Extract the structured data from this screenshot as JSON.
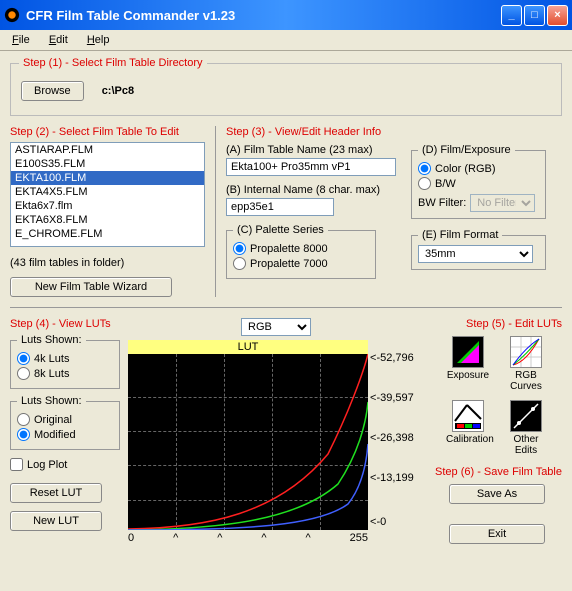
{
  "window": {
    "title": "CFR Film Table Commander v1.23",
    "min": "_",
    "max": "□",
    "close": "×"
  },
  "menu": {
    "file": "File",
    "edit": "Edit",
    "help": "Help"
  },
  "step1": {
    "legend": "Step (1) - Select Film Table Directory",
    "browse": "Browse",
    "path": "c:\\Pc8"
  },
  "step2": {
    "legend": "Step (2) - Select Film Table To Edit",
    "items": [
      "ASTIARAP.FLM",
      "E100S35.FLM",
      "EKTA100.FLM",
      "EKTA4X5.FLM",
      "Ekta6x7.flm",
      "EKTA6X8.FLM",
      "E_CHROME.FLM"
    ],
    "selected_index": 2,
    "count_label": "(43 film tables in folder)",
    "wizard": "New Film Table Wizard"
  },
  "step3": {
    "legend": "Step (3) - View/Edit Header Info",
    "a_label": "(A) Film Table Name (23 max)",
    "a_value": "Ekta100+ Pro35mm vP1",
    "b_label": "(B) Internal Name (8 char. max)",
    "b_value": "epp35e1",
    "c_legend": "(C) Palette Series",
    "c_opt1": "Propalette 8000",
    "c_opt2": "Propalette 7000",
    "d_legend": "(D) Film/Exposure",
    "d_opt1": "Color (RGB)",
    "d_opt2": "B/W",
    "d_filter_label": "BW Filter:",
    "d_filter_value": "No Filter",
    "e_legend": "(E) Film Format",
    "e_value": "35mm"
  },
  "step4": {
    "legend": "Step (4) - View LUTs",
    "luts_shown_legend": "Luts Shown:",
    "opt_4k": "4k Luts",
    "opt_8k": "8k Luts",
    "luts_shown2_legend": "Luts Shown:",
    "opt_orig": "Original",
    "opt_mod": "Modified",
    "log_plot": "Log Plot",
    "reset": "Reset LUT",
    "new": "New LUT"
  },
  "plot": {
    "channel_select": "RGB",
    "title": "LUT",
    "x_min": "0",
    "x_max": "255",
    "y_ticks": [
      "-52,796",
      "-39,597",
      "-26,398",
      "-13,199",
      "-0"
    ]
  },
  "step5": {
    "legend": "Step (5) - Edit LUTs",
    "exposure": "Exposure",
    "rgb_curves": "RGB Curves",
    "calibration": "Calibration",
    "other": "Other Edits"
  },
  "step6": {
    "legend": "Step (6) - Save Film Table",
    "save_as": "Save As",
    "exit": "Exit"
  },
  "chart_data": {
    "type": "line",
    "title": "LUT",
    "xlabel": "",
    "ylabel": "",
    "xlim": [
      0,
      255
    ],
    "ylim": [
      0,
      52796
    ],
    "series": [
      {
        "name": "Red",
        "color": "#ff2020",
        "x": [
          0,
          32,
          64,
          96,
          128,
          160,
          192,
          224,
          255
        ],
        "y": [
          200,
          600,
          1500,
          3500,
          7500,
          14000,
          24000,
          38000,
          52796
        ]
      },
      {
        "name": "Green",
        "color": "#20e020",
        "x": [
          0,
          32,
          64,
          96,
          128,
          160,
          192,
          224,
          255
        ],
        "y": [
          100,
          300,
          800,
          1800,
          3800,
          7200,
          13000,
          22000,
          36000
        ]
      },
      {
        "name": "Blue",
        "color": "#4060ff",
        "x": [
          0,
          32,
          64,
          96,
          128,
          160,
          192,
          224,
          255
        ],
        "y": [
          50,
          150,
          400,
          900,
          1900,
          3800,
          7000,
          13000,
          24000
        ]
      }
    ]
  }
}
